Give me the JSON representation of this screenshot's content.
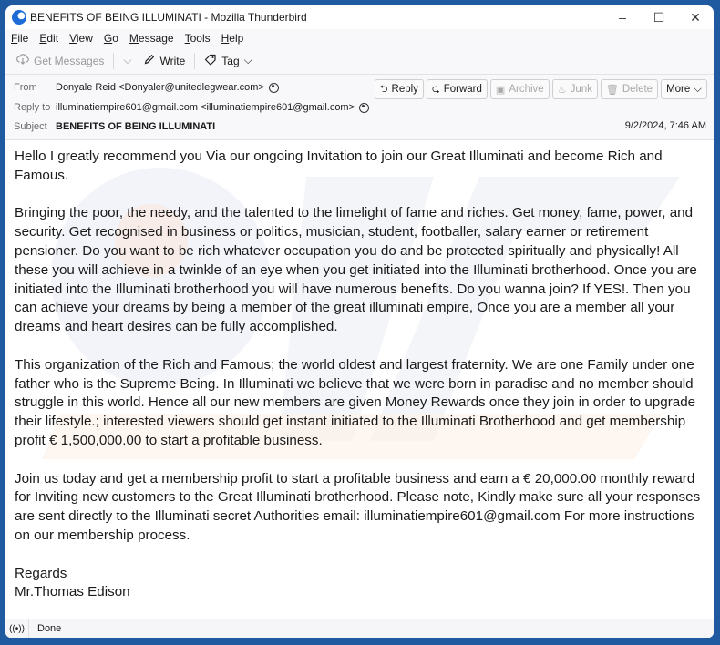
{
  "window": {
    "title": "BENEFITS OF BEING ILLUMINATI - Mozilla Thunderbird",
    "controls": {
      "minimize": "–",
      "maximize": "☐",
      "close": "✕"
    }
  },
  "menubar": {
    "items": [
      {
        "accel": "F",
        "rest": "ile"
      },
      {
        "accel": "E",
        "rest": "dit"
      },
      {
        "accel": "V",
        "rest": "iew"
      },
      {
        "accel": "G",
        "rest": "o"
      },
      {
        "accel": "M",
        "rest": "essage"
      },
      {
        "accel": "T",
        "rest": "ools"
      },
      {
        "accel": "H",
        "rest": "elp"
      }
    ]
  },
  "toolbar": {
    "get_messages": "Get Messages",
    "write": "Write",
    "tag": "Tag"
  },
  "header": {
    "from_label": "From",
    "from_value": "Donyale Reid <Donyaler@unitedlegwear.com>",
    "reply_to_label": "Reply to",
    "reply_to_value": "illuminatiempire601@gmail.com <illuminatiempire601@gmail.com>",
    "subject_label": "Subject",
    "subject_value": "BENEFITS OF BEING ILLUMINATI",
    "date": "9/2/2024, 7:46 AM",
    "actions": {
      "reply": "Reply",
      "forward": "Forward",
      "archive": "Archive",
      "junk": "Junk",
      "delete": "Delete",
      "more": "More"
    }
  },
  "message": {
    "paragraphs": [
      "Hello I greatly recommend you Via our ongoing Invitation to join our Great Illuminati and become Rich and Famous.",
      "Bringing the poor, the needy, and the talented to the limelight of fame and riches. Get money, fame, power, and security. Get recognised in business or politics, musician, student, footballer, salary earner or retirement pensioner. Do you want to be rich whatever occupation you do and be protected spiritually and physically! All these you will achieve in a twinkle of an eye when you get initiated into the Illuminati brotherhood. Once you are initiated into the Illuminati brotherhood you will have numerous benefits. Do you wanna join?  If YES!.  Then you can achieve your dreams by being a member of the great illuminati empire, Once you are a  member all your dreams and heart desires can be fully accomplished.",
      "This organization of the Rich and Famous; the world oldest and largest fraternity. We are one Family under one father who is the Supreme Being. In Illuminati we believe that we were born in paradise and no member should struggle in this world. Hence all our new members are given Money Rewards once they join in order to upgrade their lifestyle.; interested viewers should get instant initiated to the Illuminati Brotherhood and get membership profit € 1,500,000.00 to start a profitable business.",
      "Join us today and get a membership profit to start a profitable business and earn a € 20,000.00 monthly reward for Inviting new customers to the Great Illuminati brotherhood. Please note, Kindly make sure all your responses are sent directly to the Illuminati secret Authorities email: illuminatiempire601@gmail.com For more instructions on our membership process."
    ],
    "closing": "Regards",
    "signature": "Mr.Thomas Edison"
  },
  "statusbar": {
    "icon": "((•))",
    "text": "Done"
  },
  "colors": {
    "desktop": "#1f5aa0",
    "accent": "#1d6cd8"
  }
}
